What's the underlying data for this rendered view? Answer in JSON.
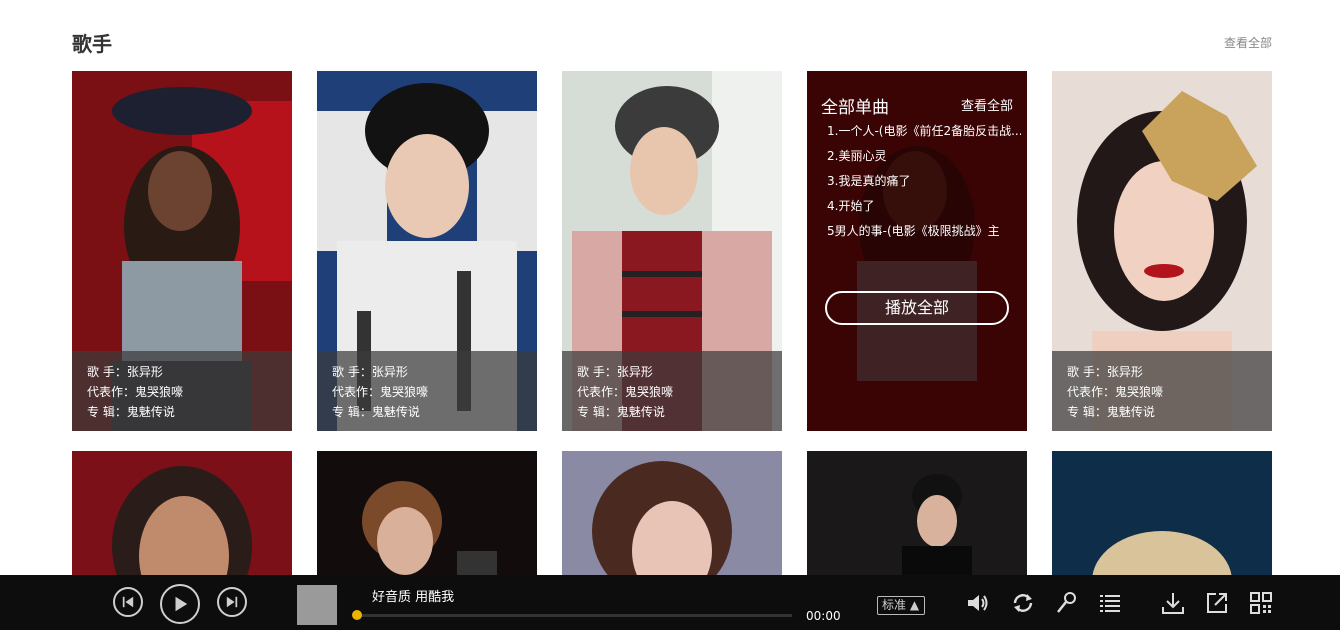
{
  "section": {
    "title": "歌手",
    "view_all": "查看全部"
  },
  "cards": [
    {
      "singer": "歌 手：张异形",
      "work": "代表作：鬼哭狼嚎",
      "album": "专 辑：鬼魅传说"
    },
    {
      "singer": "歌 手：张异形",
      "work": "代表作：鬼哭狼嚎",
      "album": "专 辑：鬼魅传说"
    },
    {
      "singer": "歌 手：张异形",
      "work": "代表作：鬼哭狼嚎",
      "album": "专 辑：鬼魅传说"
    },
    {
      "singer": "歌 手：张异形",
      "work": "代表作：鬼哭狼嚎",
      "album": "专 辑：鬼魅传说"
    }
  ],
  "overlay": {
    "title": "全部单曲",
    "view_all": "查看全部",
    "songs": [
      "1.一个人-(电影《前任2备胎反击战...",
      "2.美丽心灵",
      "3.我是真的痛了",
      "4.开始了",
      "5男人的事-(电影《极限挑战》主"
    ],
    "play_all": "播放全部"
  },
  "player": {
    "song_title": "好音质 用酷我",
    "time": "00:00",
    "quality": "标准",
    "progress": 0,
    "accent": "#f0b400",
    "icons": [
      "prev-icon",
      "play-icon",
      "next-icon",
      "volume-icon",
      "loop-icon",
      "mic-icon",
      "playlist-icon",
      "download-icon",
      "share-icon",
      "qrcode-icon"
    ]
  }
}
